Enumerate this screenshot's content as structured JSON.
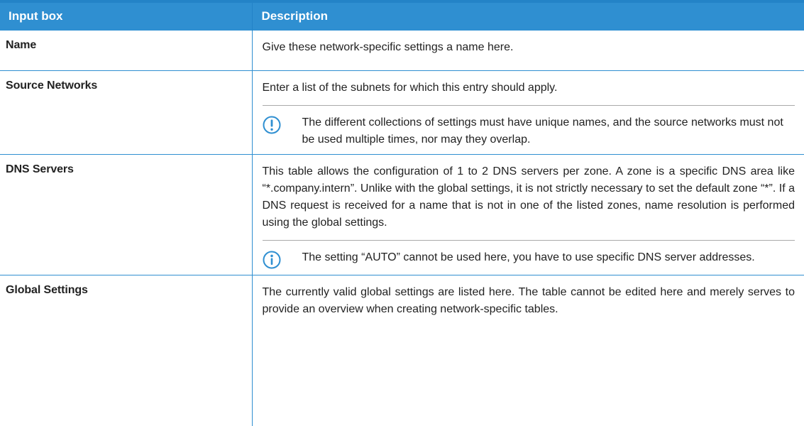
{
  "table": {
    "headers": [
      "Input box",
      "Description"
    ],
    "rows": [
      {
        "label": "Name",
        "description": "Give these network-specific settings a name here."
      },
      {
        "label": "Source Networks",
        "description": "Enter a list of the subnets for which this entry should apply.",
        "note": {
          "icon": "exclamation-circle-icon",
          "text": "The different collections of settings must have unique names, and the source networks must not be used multiple times, nor may they overlap."
        }
      },
      {
        "label": "DNS Servers",
        "description": "This table allows the configuration of 1 to 2 DNS servers per zone. A zone is a specific DNS area like “*.company.intern”. Unlike with the global settings, it is not strictly necessary to set the default zone “*”. If a DNS request is received for a name that is not in one of the listed zones, name resolution is performed using the global settings.",
        "note": {
          "icon": "info-circle-icon",
          "text": "The setting “AUTO” cannot be used here, you have to use specific DNS server addresses."
        }
      },
      {
        "label": "Global Settings",
        "description": "The currently valid global settings are listed here. The table cannot be edited here and merely serves to provide an overview when creating network-specific tables."
      }
    ]
  },
  "colors": {
    "header_bg": "#2f8fd1",
    "header_text": "#ffffff",
    "grid_line": "#2f8fd1",
    "icon": "#2f8fd1"
  }
}
